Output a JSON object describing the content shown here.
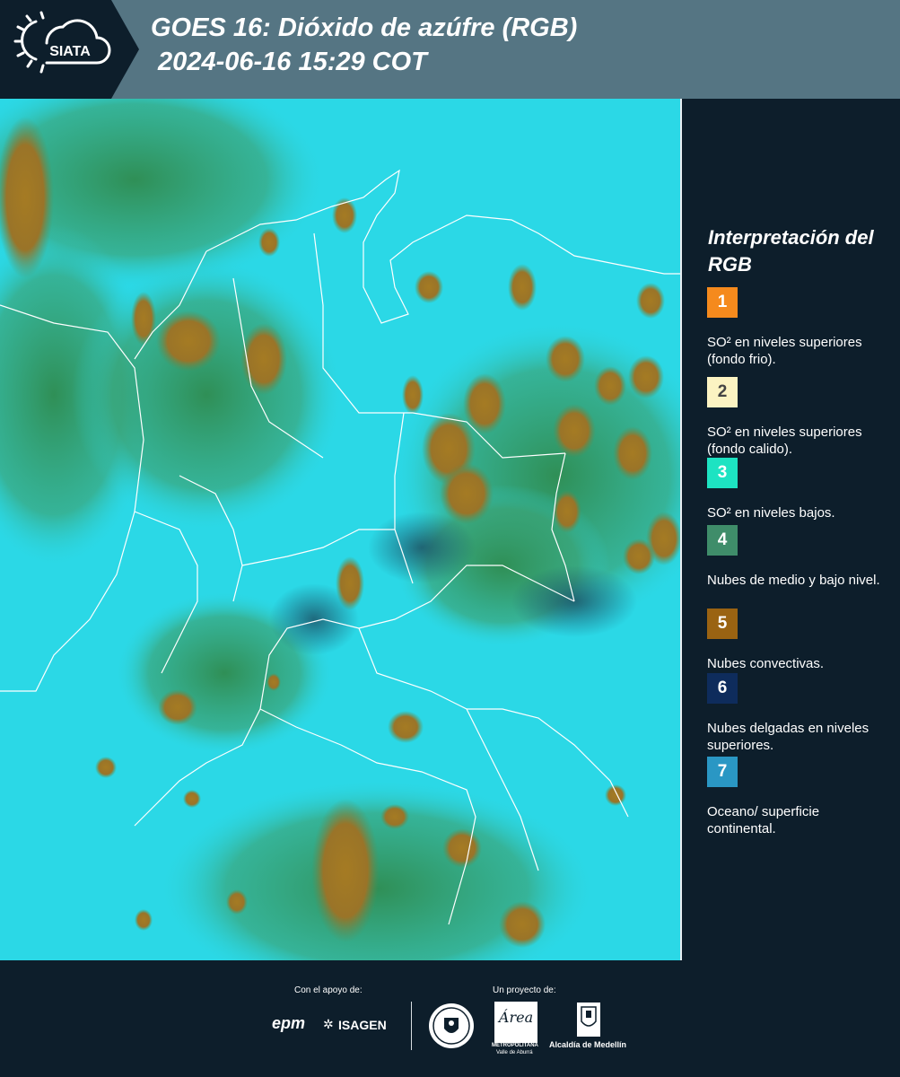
{
  "header": {
    "title": "GOES 16: Dióxido de azúfre (RGB)\n 2024-06-16 15:29 COT",
    "logo_text": "SIATA",
    "logo_icon": "sun-cloud-icon"
  },
  "legend": {
    "title": "Interpretación del RGB",
    "items": [
      {
        "number": "1",
        "color": "#f58a1d",
        "text_color": "#ffffff",
        "label": "SO² en niveles superiores (fondo frio)."
      },
      {
        "number": "2",
        "color": "#fbf3c2",
        "text_color": "#444444",
        "label": "SO² en niveles superiores (fondo calido)."
      },
      {
        "number": "3",
        "color": "#1de3c2",
        "text_color": "#ffffff",
        "label": "SO² en niveles bajos."
      },
      {
        "number": "4",
        "color": "#3f8d6a",
        "text_color": "#ffffff",
        "label": "Nubes de medio y bajo nivel."
      },
      {
        "number": "5",
        "color": "#9a6312",
        "text_color": "#ffffff",
        "label": "Nubes convectivas."
      },
      {
        "number": "6",
        "color": "#0e2c5c",
        "text_color": "#ffffff",
        "label": "Nubes delgadas en niveles superiores."
      },
      {
        "number": "7",
        "color": "#2a97c4",
        "text_color": "#ffffff",
        "label": "Oceano/ superficie continental."
      }
    ]
  },
  "footer": {
    "support_label": "Con el apoyo de:",
    "project_label": "Un proyecto de:",
    "epm": "epm",
    "isagen": "ISAGEN",
    "area_name": "Área",
    "area_sub": "METROPOLITANA",
    "area_sub2": "Valle de Aburrá",
    "alcaldia": "Alcaldía de Medellín"
  },
  "colors": {
    "map_base": "#29d6e4",
    "cloud_convective": "#a47a26",
    "cloud_mid": "#3a9a6c",
    "borders": "#ffffff"
  }
}
